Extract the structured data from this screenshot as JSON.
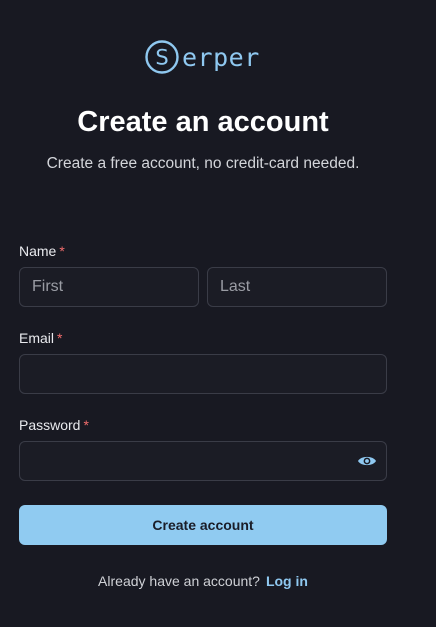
{
  "brand": {
    "name": "erper",
    "logo_letter": "S",
    "color": "#8fc8f0"
  },
  "header": {
    "title": "Create an account",
    "subtitle": "Create a free account, no credit-card needed."
  },
  "form": {
    "required_marker": "*",
    "name": {
      "label": "Name",
      "first_placeholder": "First",
      "last_placeholder": "Last"
    },
    "email": {
      "label": "Email",
      "value": ""
    },
    "password": {
      "label": "Password",
      "value": "",
      "toggle_icon": "eye-icon"
    },
    "submit_label": "Create account"
  },
  "footer": {
    "prompt": "Already have an account?",
    "login_label": "Log in"
  },
  "colors": {
    "background": "#181922",
    "accent": "#90cbf1",
    "required": "#f26d6d",
    "border": "#3a3c47"
  }
}
